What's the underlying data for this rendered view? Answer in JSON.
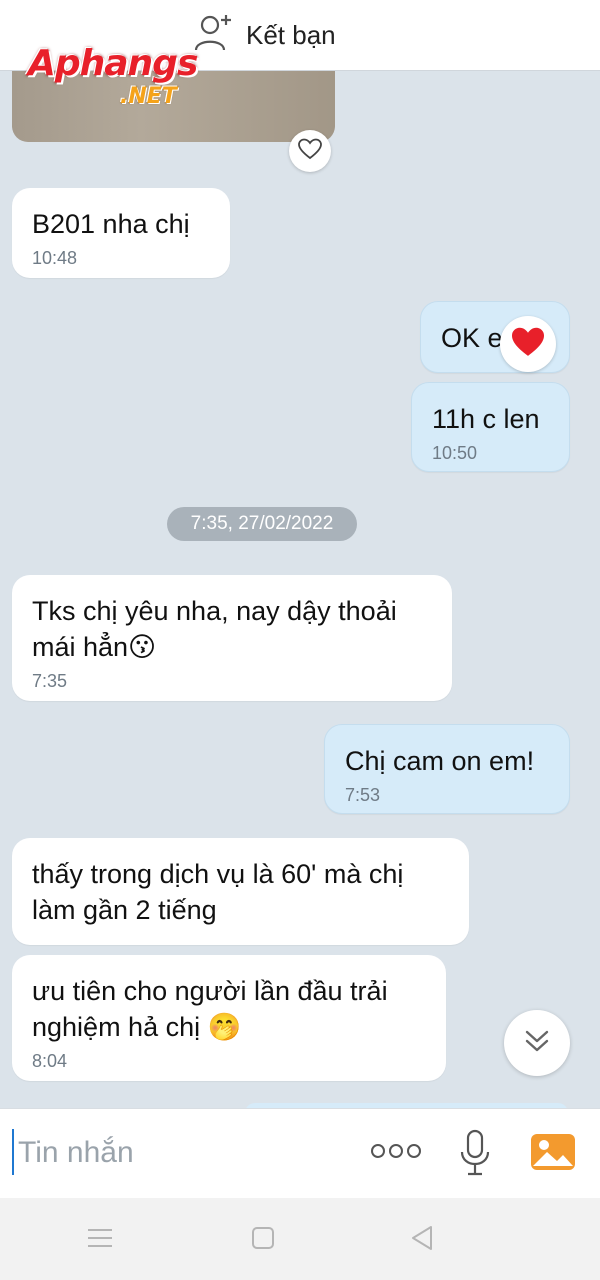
{
  "header": {
    "add_friend_label": "Kết bạn"
  },
  "watermark": {
    "line1": "Aphangs",
    "line2": ".NET"
  },
  "messages": [
    {
      "dir": "in",
      "text": "B201 nha chị",
      "time": "10:48"
    },
    {
      "dir": "out",
      "text": "OK em",
      "time": "",
      "reaction": "heart"
    },
    {
      "dir": "out",
      "text": "11h c len",
      "time": "10:50"
    },
    {
      "dir": "in",
      "text": "Tks chị yêu nha, nay dậy thoải mái hẳn😗",
      "time": "7:35"
    },
    {
      "dir": "out",
      "text": "Chị cam on em!",
      "time": "7:53"
    },
    {
      "dir": "in",
      "text": "thấy trong dịch vụ là 60' mà chị làm gần 2 tiếng",
      "time": ""
    },
    {
      "dir": "in",
      "text": "ưu tiên cho người lần đầu trải nghiệm hả chị 🤭",
      "time": "8:04"
    }
  ],
  "date_separator": "7:35, 27/02/2022",
  "composer": {
    "placeholder": "Tin nhắn",
    "value": ""
  },
  "colors": {
    "accent": "#1f78d1",
    "outgoing_bubble": "#d6ebf9",
    "background": "#dbe3ea",
    "gallery_icon": "#f39a2e"
  },
  "icons": [
    "add-friend-icon",
    "heart-outline-icon",
    "heart-reaction-icon",
    "chevron-double-down-icon",
    "more-options-icon",
    "microphone-icon",
    "gallery-icon",
    "menu-icon",
    "home-square-icon",
    "back-triangle-icon"
  ]
}
